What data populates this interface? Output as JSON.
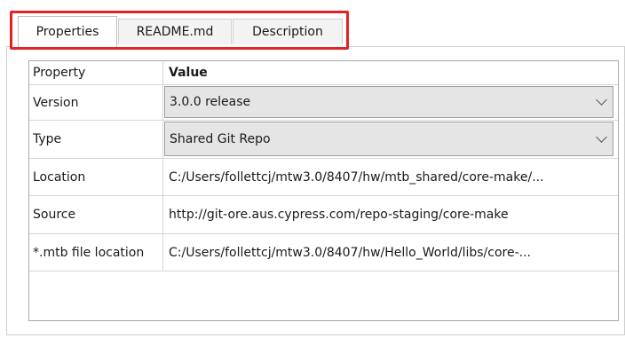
{
  "tabs": [
    {
      "label": "Properties",
      "active": true
    },
    {
      "label": "README.md",
      "active": false
    },
    {
      "label": "Description",
      "active": false
    }
  ],
  "highlight_color": "#e32224",
  "grid": {
    "headers": {
      "property": "Property",
      "value": "Value"
    },
    "rows": [
      {
        "name": "Version",
        "value": "3.0.0 release",
        "kind": "dropdown"
      },
      {
        "name": "Type",
        "value": "Shared Git Repo",
        "kind": "dropdown"
      },
      {
        "name": "Location",
        "value": "C:/Users/follettcj/mtw3.0/8407/hw/mtb_shared/core-make/...",
        "kind": "text"
      },
      {
        "name": "Source",
        "value": "http://git-ore.aus.cypress.com/repo-staging/core-make",
        "kind": "text"
      },
      {
        "name": "*.mtb file location",
        "value": "C:/Users/follettcj/mtw3.0/8407/hw/Hello_World/libs/core-...",
        "kind": "text"
      }
    ]
  }
}
